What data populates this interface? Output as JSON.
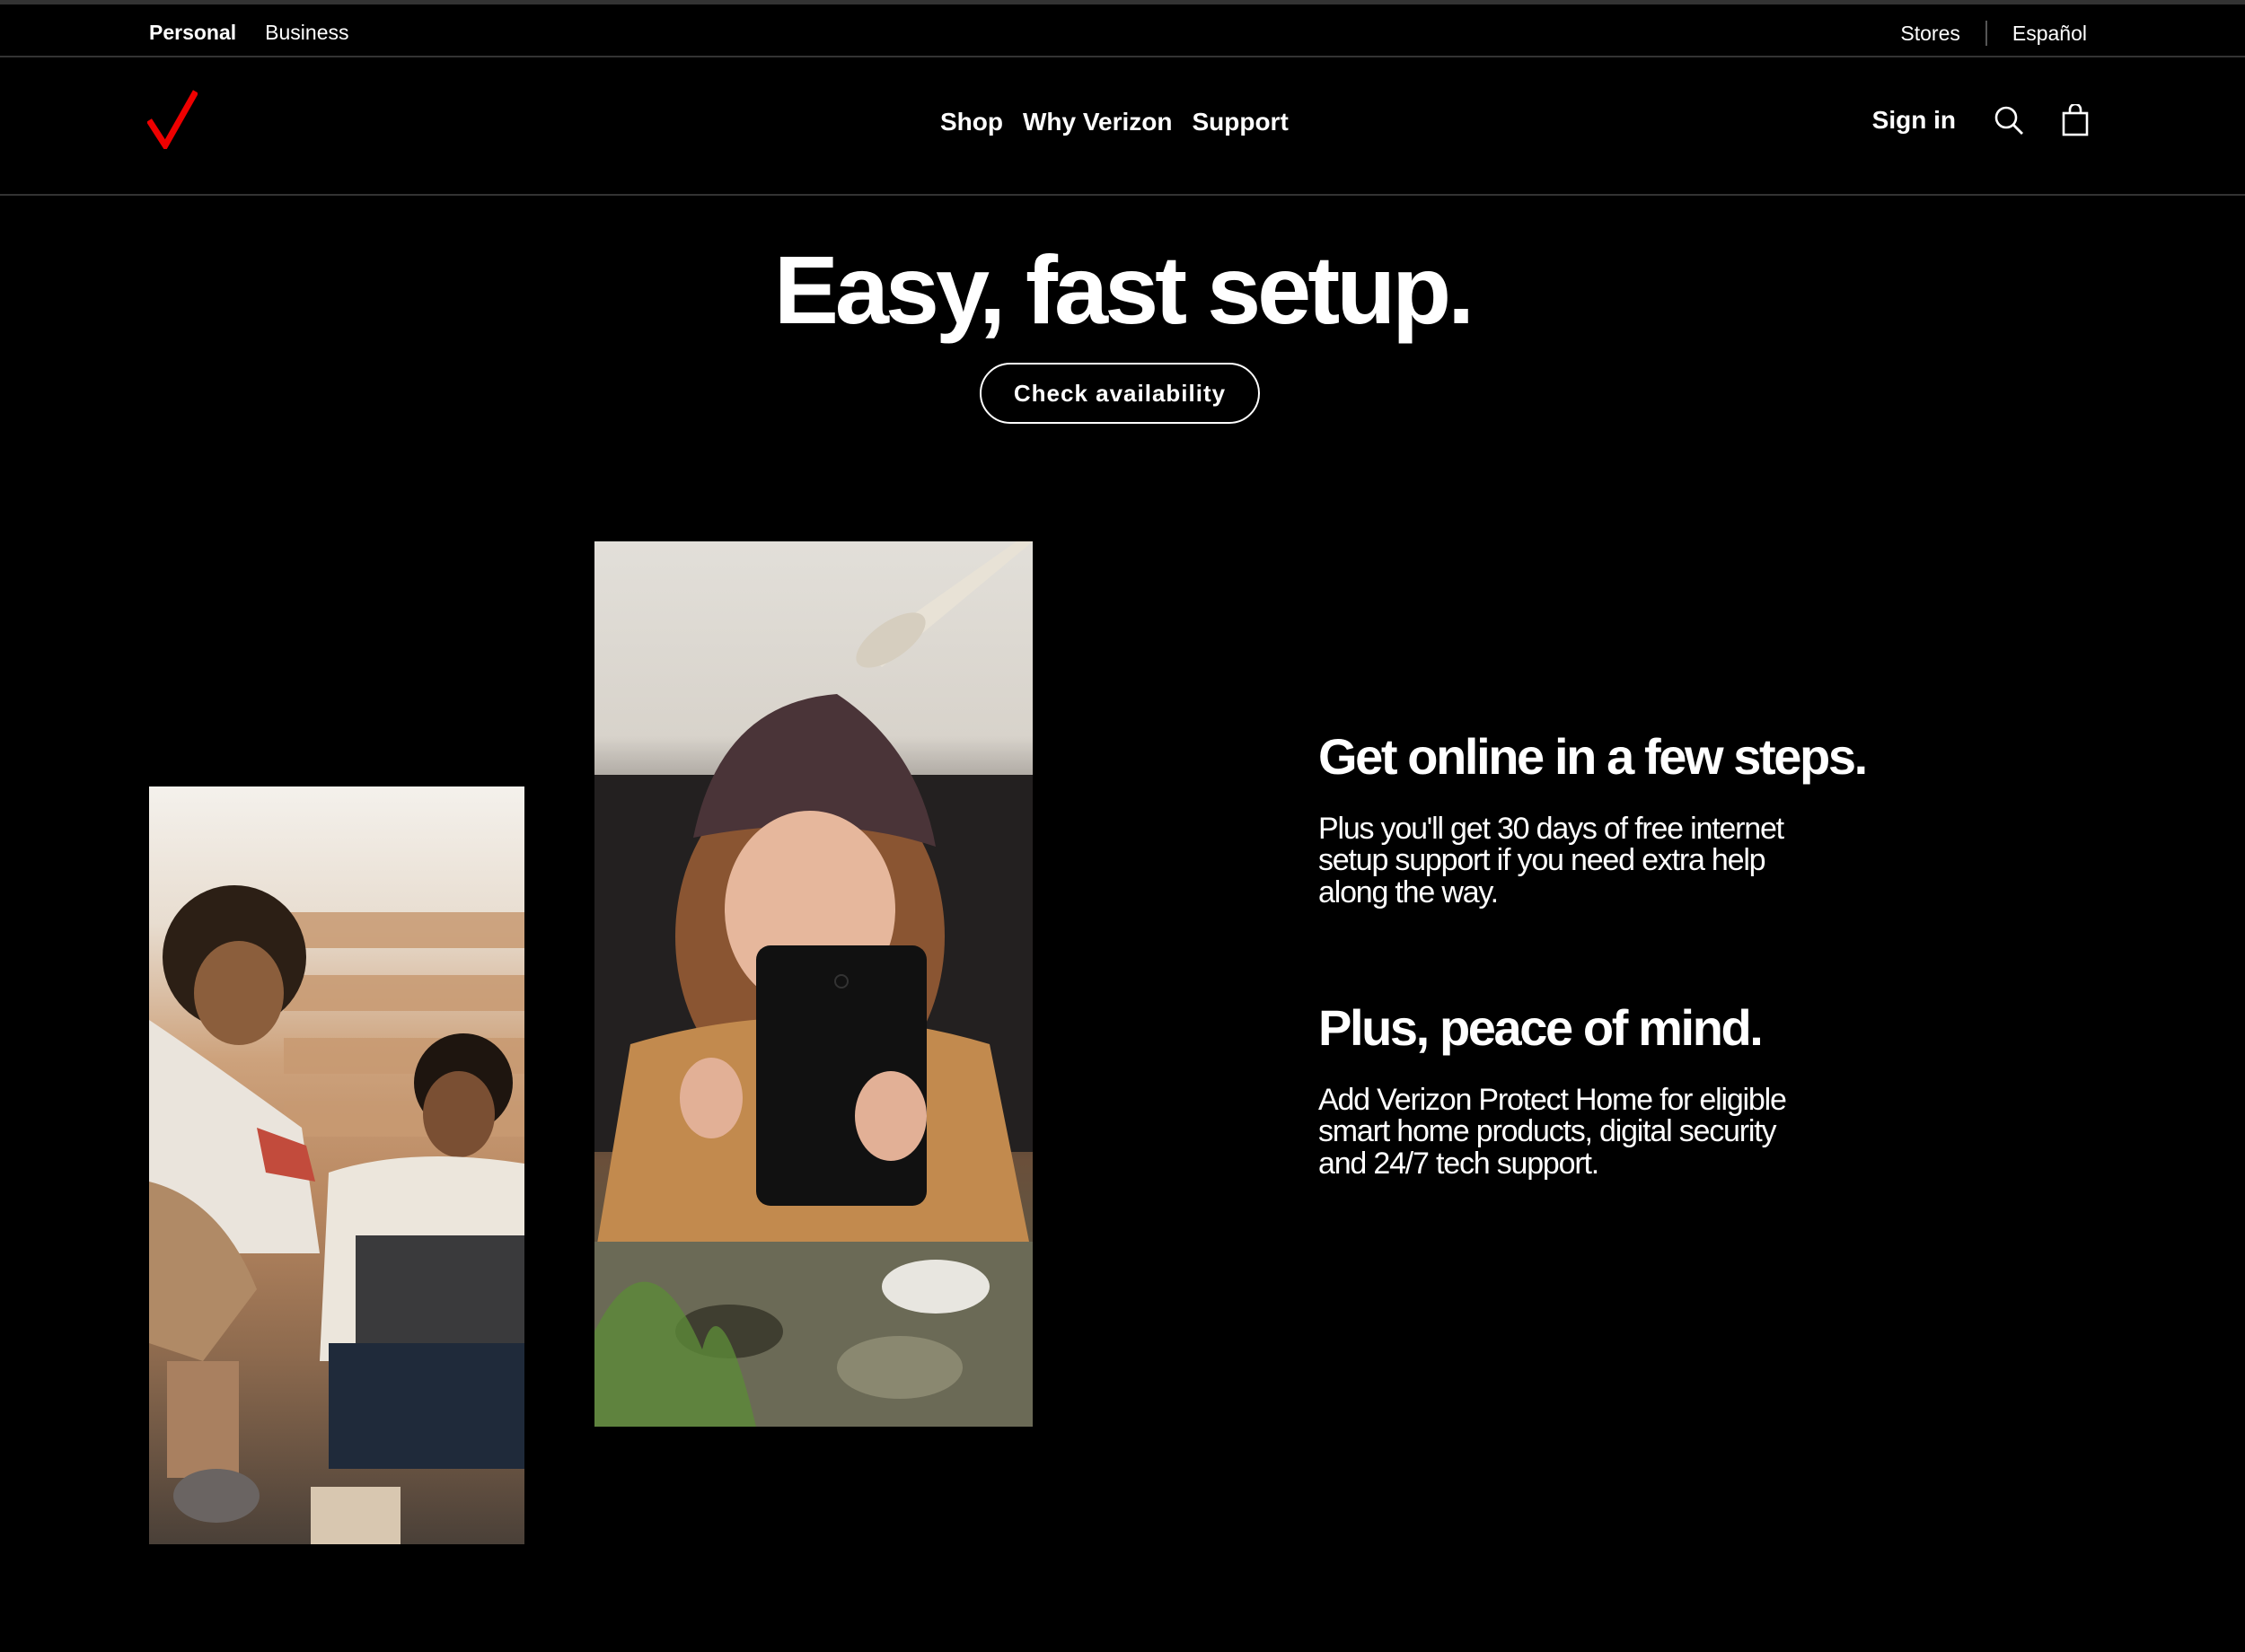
{
  "utility": {
    "personal": "Personal",
    "business": "Business",
    "stores": "Stores",
    "espanol": "Español"
  },
  "nav": {
    "shop": "Shop",
    "why_verizon": "Why Verizon",
    "support": "Support",
    "sign_in": "Sign in",
    "logo_color": "#ee0000"
  },
  "hero": {
    "title": "Easy, fast setup.",
    "cta": "Check availability"
  },
  "features": [
    {
      "heading": "Get online in a few steps.",
      "body": "Plus you'll get 30 days of free internet setup support if you need extra help along the way."
    },
    {
      "heading": "Plus, peace of mind.",
      "body": "Add Verizon Protect Home for eligible smart home products, digital security and 24/7 tech support."
    }
  ],
  "icons": {
    "search": "search-icon",
    "cart": "shopping-bag-icon",
    "logo": "verizon-checkmark-icon"
  }
}
